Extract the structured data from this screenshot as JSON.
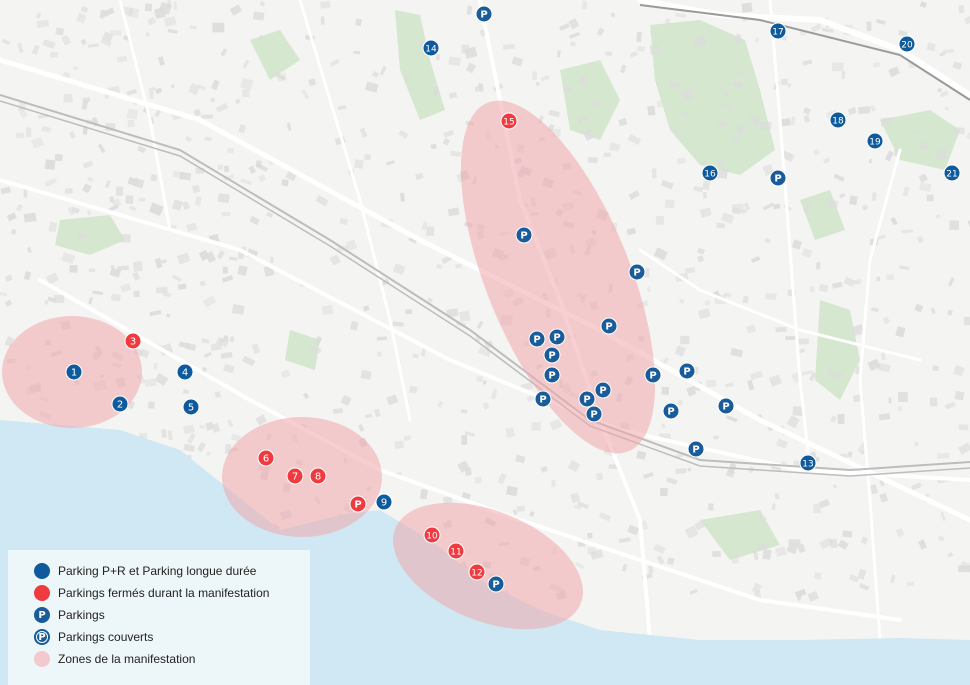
{
  "colors": {
    "parking_pr": "#0e5a9c",
    "parking_closed": "#ef3b40",
    "parking": "#1a5b9a",
    "zone_fill": "#f0b8bc",
    "water": "#cfe8f3",
    "land": "#f4f4f2",
    "green": "#cfe3c8"
  },
  "markers": [
    {
      "label": "1",
      "kind": "pr"
    },
    {
      "label": "2",
      "kind": "pr"
    },
    {
      "label": "3",
      "kind": "closed"
    },
    {
      "label": "4",
      "kind": "pr"
    },
    {
      "label": "5",
      "kind": "pr"
    },
    {
      "label": "6",
      "kind": "closed"
    },
    {
      "label": "7",
      "kind": "closed"
    },
    {
      "label": "8",
      "kind": "closed"
    },
    {
      "label": "9",
      "kind": "pr"
    },
    {
      "label": "10",
      "kind": "closed"
    },
    {
      "label": "11",
      "kind": "closed"
    },
    {
      "label": "12",
      "kind": "closed"
    },
    {
      "label": "13",
      "kind": "pr"
    },
    {
      "label": "14",
      "kind": "pr"
    },
    {
      "label": "15",
      "kind": "closed"
    },
    {
      "label": "16",
      "kind": "pr"
    },
    {
      "label": "17",
      "kind": "pr"
    },
    {
      "label": "18",
      "kind": "pr"
    },
    {
      "label": "19",
      "kind": "pr"
    },
    {
      "label": "20",
      "kind": "pr"
    },
    {
      "label": "21",
      "kind": "pr"
    }
  ],
  "parking_marker_label": "P",
  "legend": {
    "items": [
      {
        "symbol": "dot-pr",
        "label": "Parking P+R et Parking longue durée"
      },
      {
        "symbol": "dot-closed",
        "label": "Parkings fermés durant la manifestation"
      },
      {
        "symbol": "p",
        "label": "Parkings"
      },
      {
        "symbol": "p-covered",
        "label": "Parkings couverts"
      },
      {
        "symbol": "zone",
        "label": "Zones de la manifestation"
      }
    ]
  }
}
